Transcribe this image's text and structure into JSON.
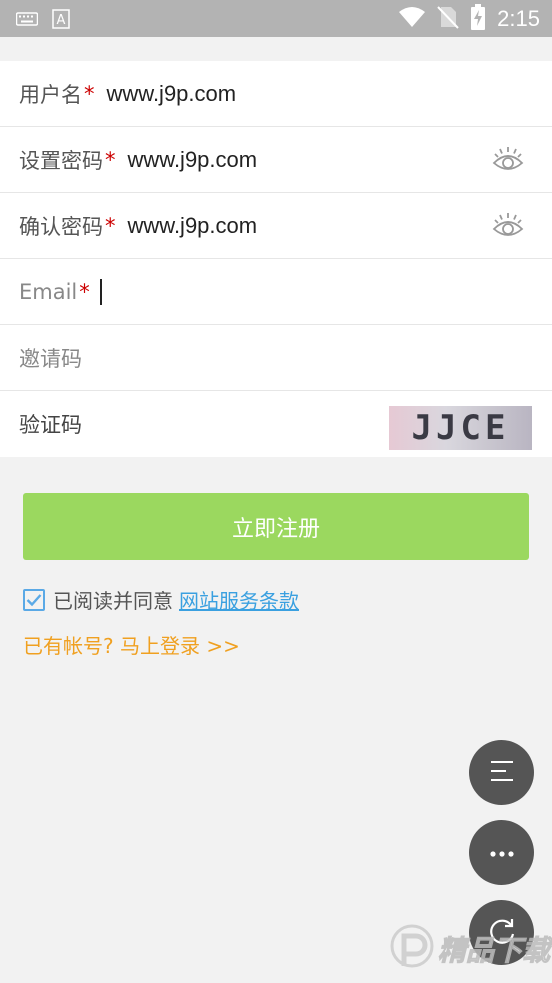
{
  "status_bar": {
    "time": "2:15",
    "icons": [
      "keyboard-icon",
      "font-icon",
      "wifi-icon",
      "no-sim-icon",
      "battery-charging-icon"
    ]
  },
  "form": {
    "username": {
      "label": "用户名",
      "required_mark": "*",
      "value": "www.j9p.com"
    },
    "password": {
      "label": "设置密码",
      "required_mark": "*",
      "value": "www.j9p.com"
    },
    "confirm_password": {
      "label": "确认密码",
      "required_mark": "*",
      "value": "www.j9p.com"
    },
    "email": {
      "label": "Email",
      "required_mark": "*",
      "value": ""
    },
    "invite_code": {
      "label": "邀请码",
      "value": ""
    },
    "captcha": {
      "label": "验证码",
      "image_text": "JJCE"
    }
  },
  "register_button": {
    "label": "立即注册"
  },
  "agreement": {
    "checked": true,
    "text": "已阅读并同意",
    "link": "网站服务条款"
  },
  "login_link": {
    "label": "已有帐号? 马上登录 >>"
  },
  "fab_buttons": [
    "menu-icon",
    "more-icon",
    "refresh-icon"
  ],
  "watermark": {
    "text": "精品下载"
  },
  "colors": {
    "accent_green": "#9bd85f",
    "link_blue": "#3aa0e0",
    "login_orange": "#f0a020",
    "required_red": "#cc0000"
  }
}
